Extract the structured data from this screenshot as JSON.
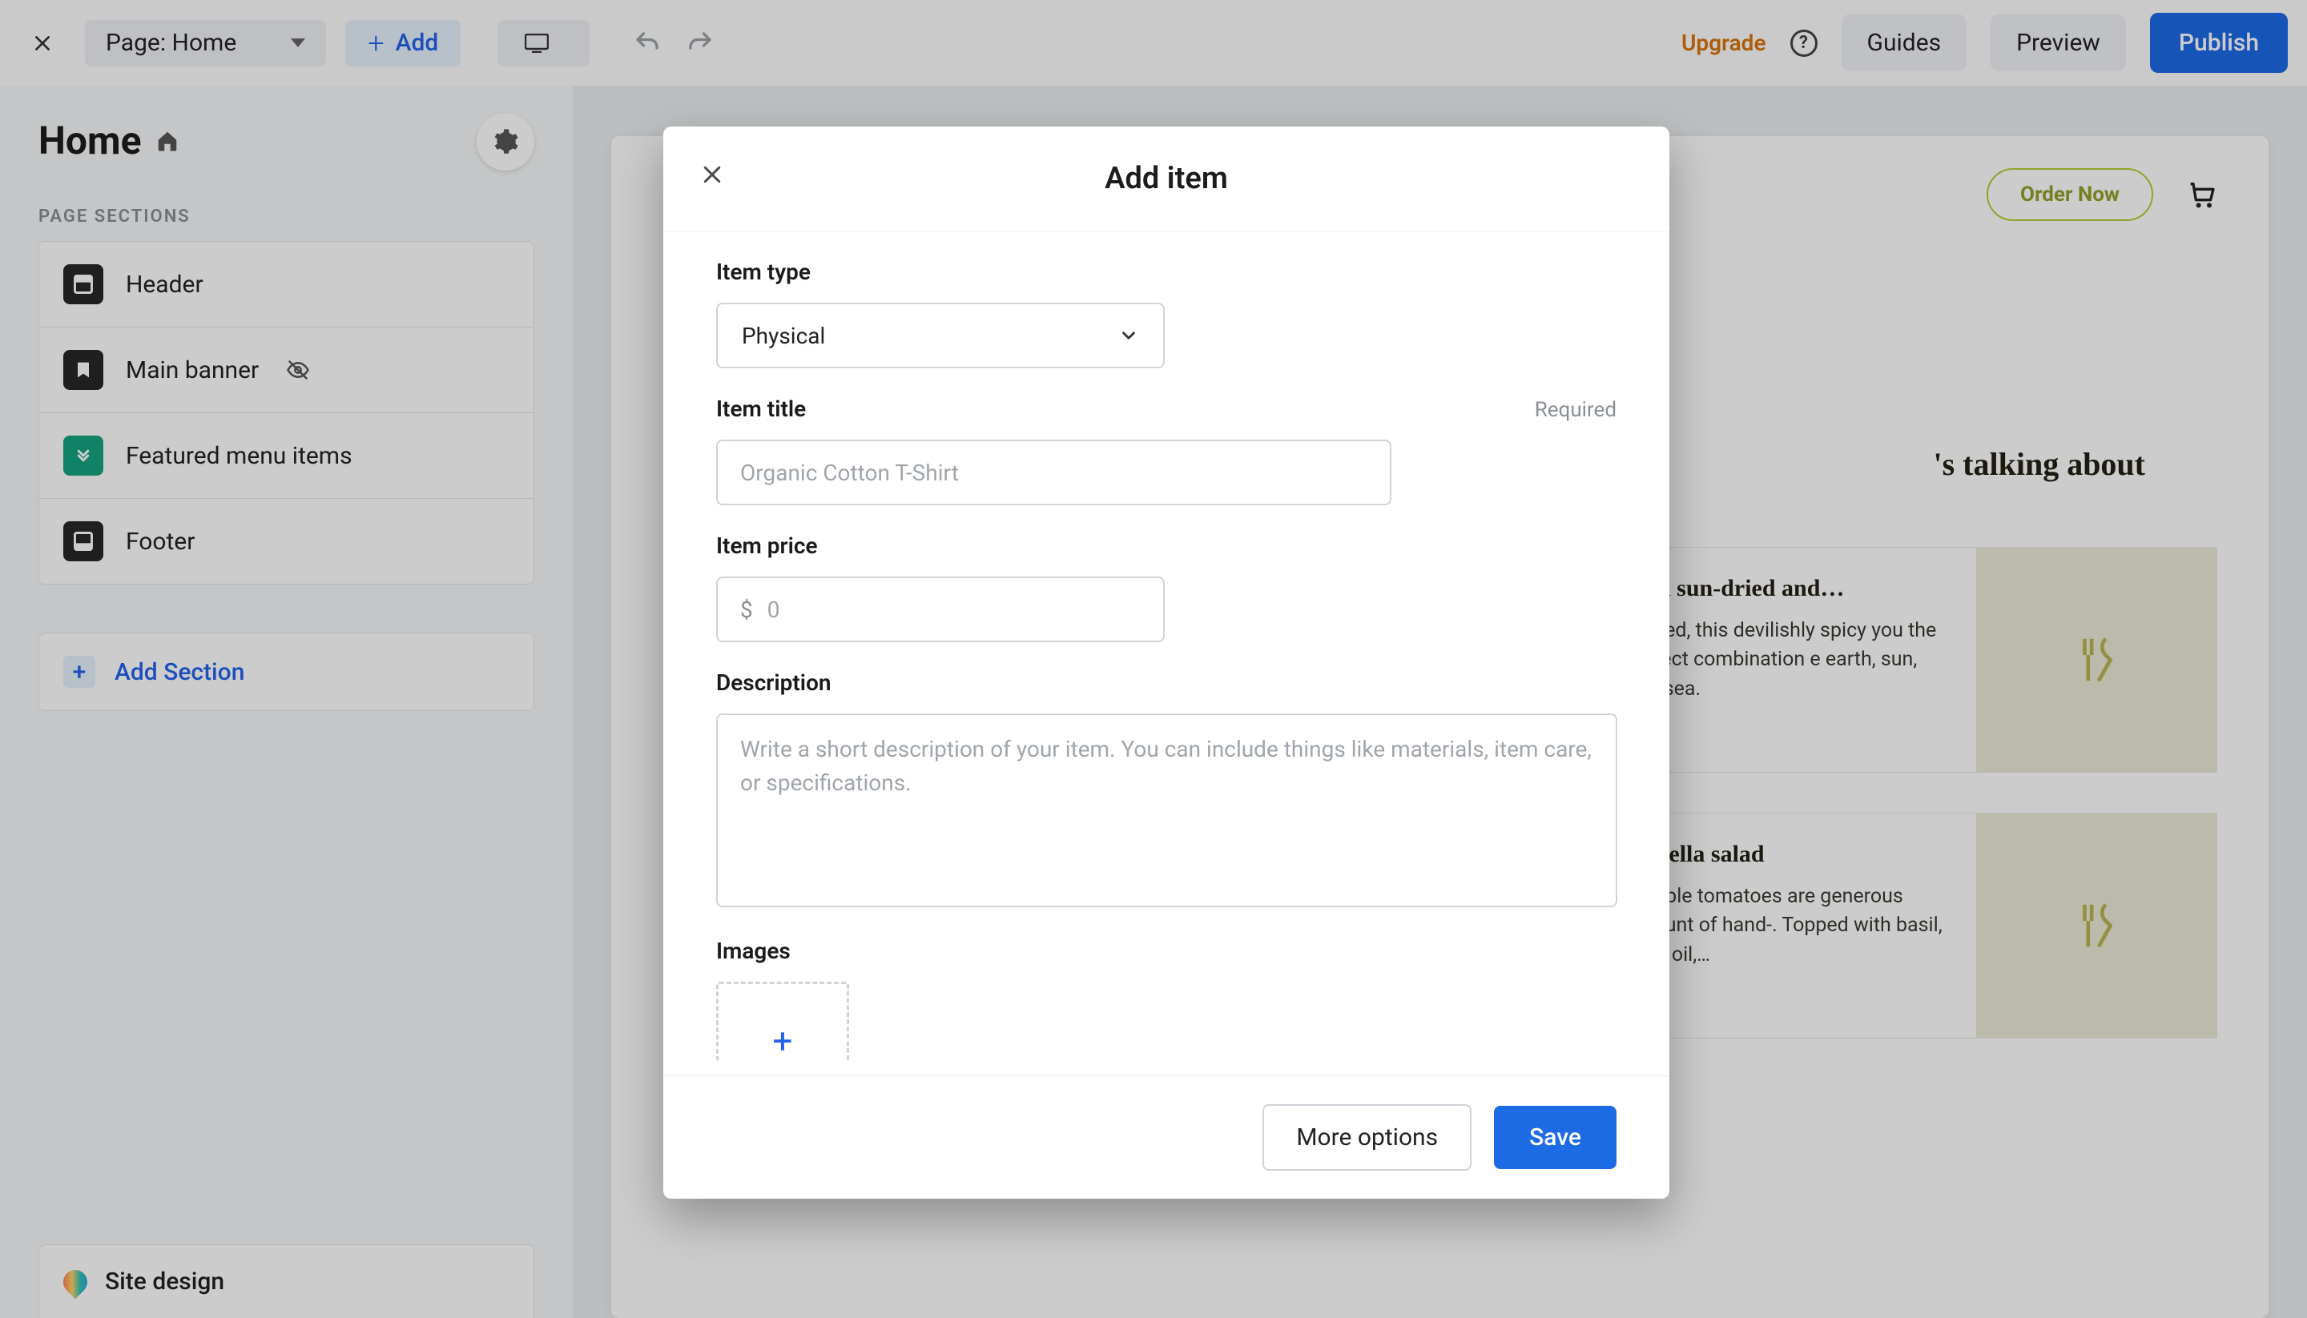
{
  "topbar": {
    "page_label": "Page: Home",
    "add_label": "Add",
    "upgrade": "Upgrade",
    "guides": "Guides",
    "preview": "Preview",
    "publish": "Publish"
  },
  "sidebar": {
    "title": "Home",
    "sections_heading": "PAGE SECTIONS",
    "items": [
      {
        "label": "Header"
      },
      {
        "label": "Main banner"
      },
      {
        "label": "Featured menu items"
      },
      {
        "label": "Footer"
      }
    ],
    "add_section": "Add Section",
    "site_design": "Site design"
  },
  "canvas": {
    "order_now": "Order Now",
    "feature_heading": "'s talking about",
    "cards": [
      {
        "title": "with sun-dried and…",
        "body": "ticated, this devilishly spicy you the perfect combination e earth, sun, and sea."
      },
      {
        "title": "zzarella salad",
        "body": " to table tomatoes are generous amount of hand-. Topped with basil, olive oil,…"
      }
    ]
  },
  "modal": {
    "title": "Add item",
    "item_type_label": "Item type",
    "item_type_value": "Physical",
    "item_title_label": "Item title",
    "required": "Required",
    "title_placeholder": "Organic Cotton T-Shirt",
    "price_label": "Item price",
    "price_currency": "$",
    "price_placeholder": "0",
    "desc_label": "Description",
    "desc_placeholder": "Write a short description of your item. You can include things like materials, item care, or specifications.",
    "images_label": "Images",
    "more_options": "More options",
    "save": "Save"
  }
}
